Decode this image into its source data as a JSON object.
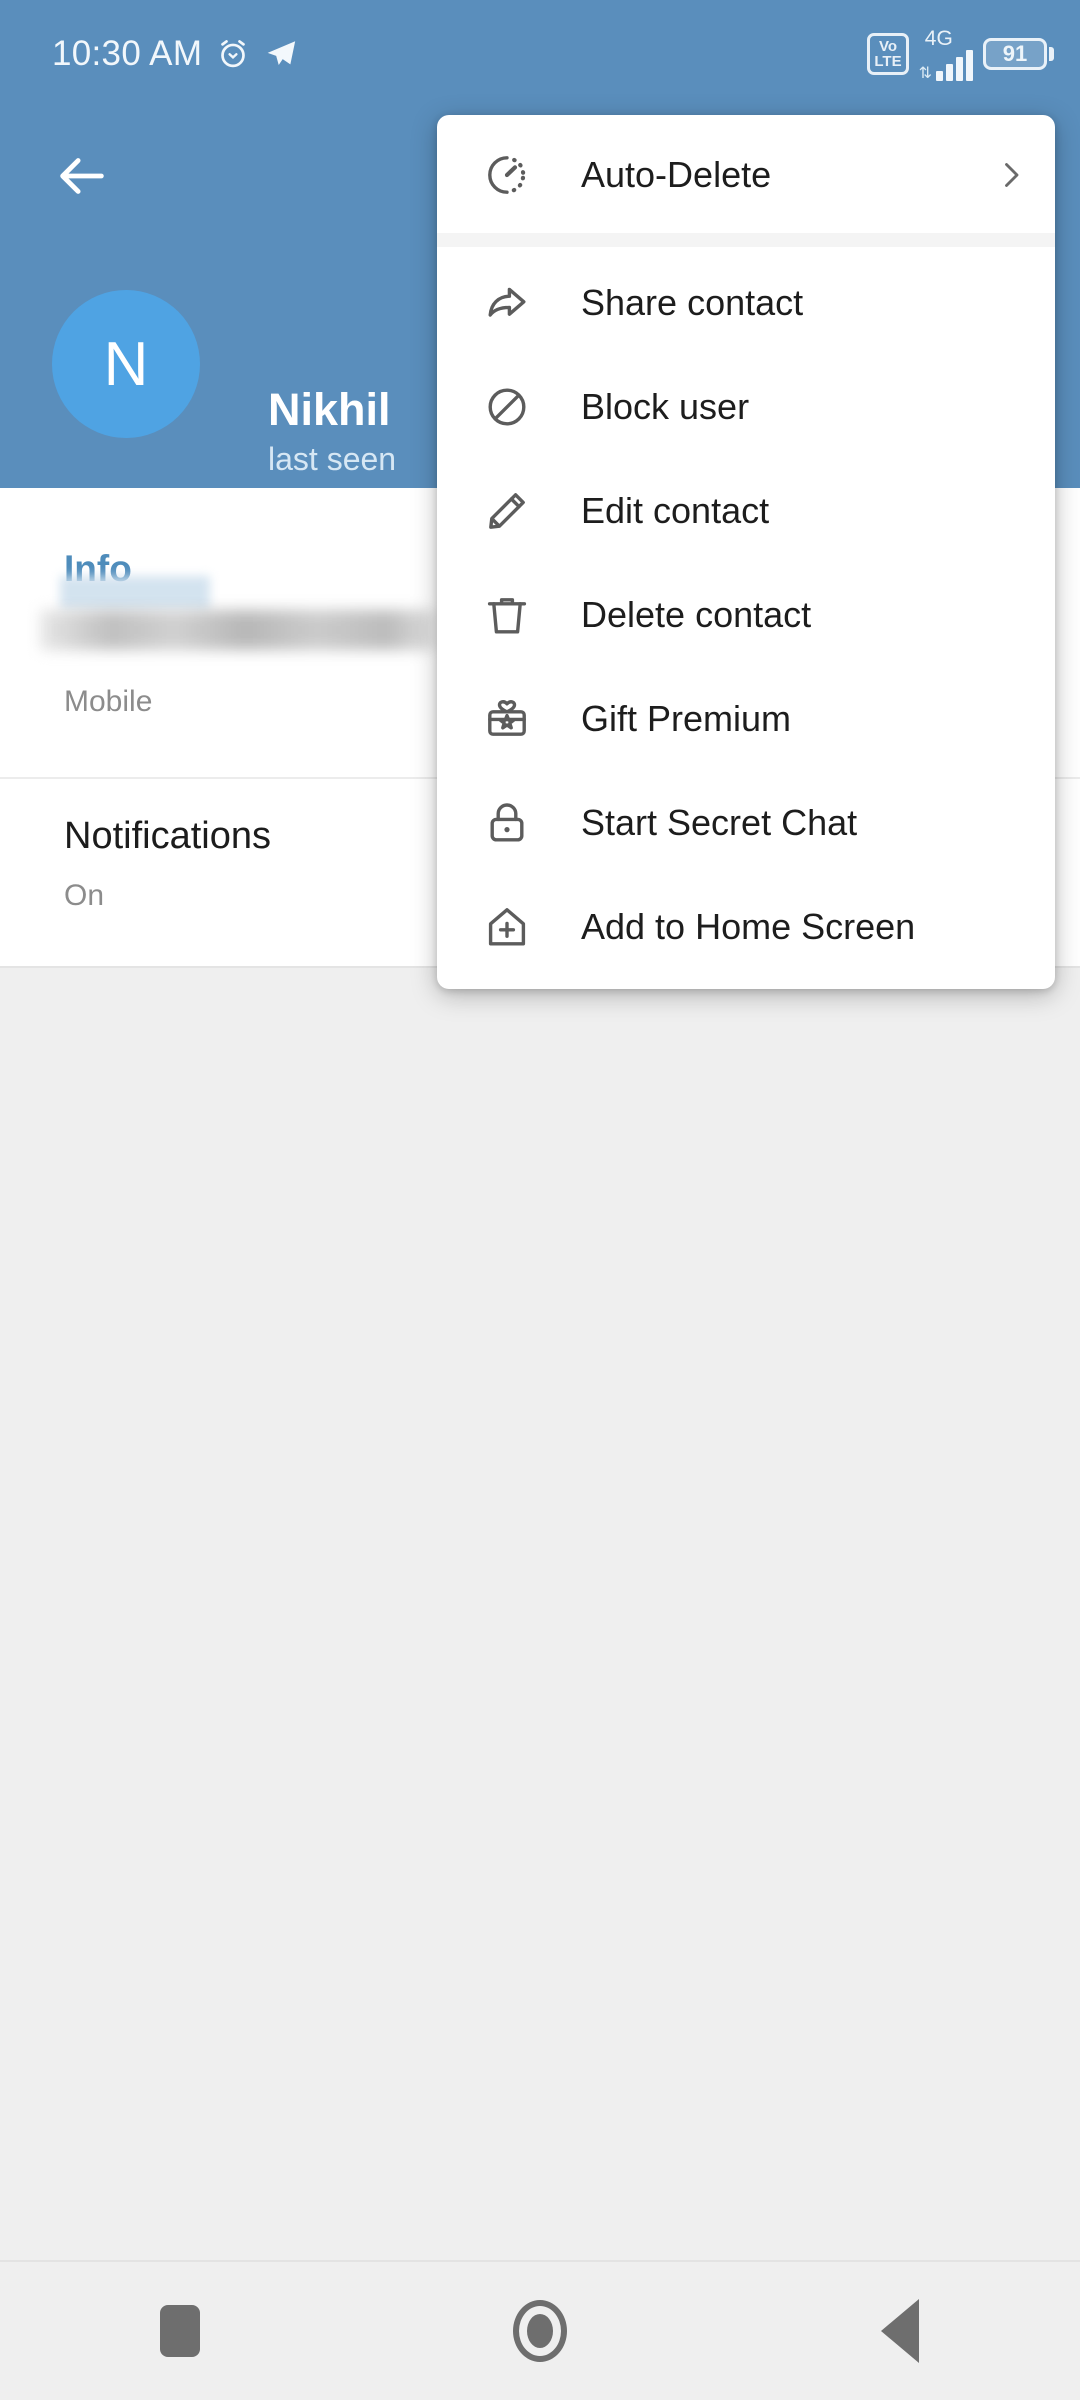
{
  "statusbar": {
    "time": "10:30 AM",
    "alarm_icon": "alarm-clock-icon",
    "app_icon": "telegram-paper-plane-icon",
    "volte_line1": "Vo",
    "volte_line2": "LTE",
    "network_type": "4G",
    "data_arrows": "⇅",
    "signal_bars": 4,
    "battery_percent": "91"
  },
  "header": {
    "back_icon": "back-arrow-icon",
    "avatar_initial": "N",
    "contact_name": "Nikhil",
    "contact_status": "last seen",
    "bg_color": "#5a8ebc",
    "avatar_color": "#4fa3e3"
  },
  "info_card": {
    "section_title": "Info",
    "phone_label": "Mobile",
    "phone_value_redacted": true,
    "notifications_title": "Notifications",
    "notifications_value": "On"
  },
  "menu": {
    "items": [
      {
        "label": "Auto-Delete",
        "icon": "auto-delete-timer-icon",
        "has_chevron": true
      },
      {
        "label": "Share contact",
        "icon": "share-arrow-icon",
        "has_chevron": false
      },
      {
        "label": "Block user",
        "icon": "block-circle-slash-icon",
        "has_chevron": false
      },
      {
        "label": "Edit contact",
        "icon": "pencil-edit-icon",
        "has_chevron": false
      },
      {
        "label": "Delete contact",
        "icon": "trash-can-icon",
        "has_chevron": false
      },
      {
        "label": "Gift Premium",
        "icon": "gift-box-icon",
        "has_chevron": false
      },
      {
        "label": "Start Secret Chat",
        "icon": "padlock-icon",
        "has_chevron": false
      },
      {
        "label": "Add to Home Screen",
        "icon": "home-plus-icon",
        "has_chevron": false
      }
    ],
    "chevron_icon": "chevron-right-icon"
  },
  "navbar": {
    "recents_icon": "recents-square-icon",
    "home_icon": "home-circle-icon",
    "back_icon": "back-triangle-icon"
  }
}
